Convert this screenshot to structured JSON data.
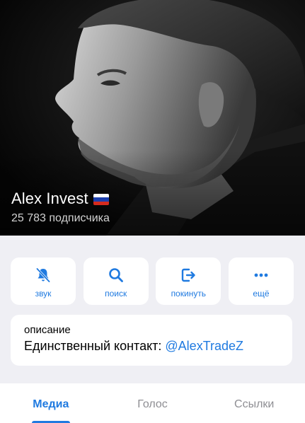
{
  "channel": {
    "name": "Alex Invest",
    "flag_icon": "russia-flag-icon",
    "subscribers": "25 783 подписчика"
  },
  "actions": [
    {
      "label": "звук",
      "icon": "mute-bell-icon"
    },
    {
      "label": "поиск",
      "icon": "search-icon"
    },
    {
      "label": "покинуть",
      "icon": "leave-icon"
    },
    {
      "label": "ещё",
      "icon": "more-dots-icon"
    }
  ],
  "about": {
    "caption": "описание",
    "text": "Единственный контакт:",
    "link": "@AlexTradeZ"
  },
  "tabs": [
    {
      "label": "Медиа",
      "active": true
    },
    {
      "label": "Голос",
      "active": false
    },
    {
      "label": "Ссылки",
      "active": false
    }
  ],
  "colors": {
    "accent": "#1f7ae0",
    "background": "#efeff4",
    "card": "#ffffff",
    "inactive_tab": "#8e8e93"
  }
}
